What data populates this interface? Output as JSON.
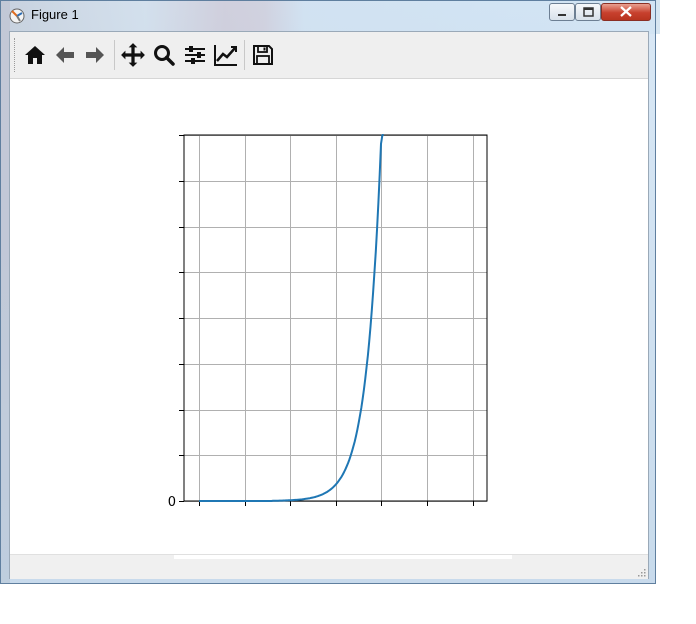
{
  "window": {
    "title": "Figure 1"
  },
  "toolbar": {
    "buttons": [
      {
        "name": "home-icon"
      },
      {
        "name": "back-arrow-icon"
      },
      {
        "name": "forward-arrow-icon"
      },
      {
        "name": "pan-move-icon"
      },
      {
        "name": "zoom-magnifier-icon"
      },
      {
        "name": "configure-subplots-icon"
      },
      {
        "name": "edit-axis-lines-icon"
      },
      {
        "name": "save-floppy-icon"
      }
    ]
  },
  "chart_data": {
    "type": "line",
    "title": "",
    "xlabel": "",
    "ylabel": "",
    "grid": true,
    "y_tick_labels": [
      "0"
    ],
    "x_tick_count": 7,
    "y_tick_count": 9,
    "series": [
      {
        "color": "#1f77b4",
        "x": [
          0,
          1,
          2,
          2.5,
          2.8,
          3.0,
          3.2,
          3.4,
          3.6,
          3.8,
          4.0,
          4.05
        ],
        "y": [
          0,
          0,
          0.002,
          0.01,
          0.03,
          0.06,
          0.12,
          0.24,
          0.45,
          0.78,
          1.0,
          1.0
        ]
      }
    ],
    "colors": {
      "line": "#1f77b4",
      "grid": "#b0b0b0",
      "axes": "#000000"
    }
  }
}
